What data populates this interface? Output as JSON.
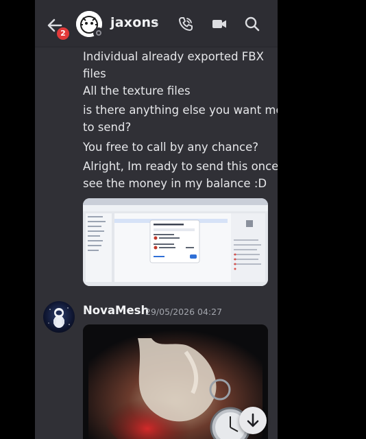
{
  "header": {
    "username": "jaxons",
    "chevron": "›",
    "back_badge": "2",
    "icons": [
      "back-arrow-icon",
      "phone-call-icon",
      "video-call-icon",
      "search-icon"
    ]
  },
  "messages": {
    "lines": [
      "Individual already exported FBX",
      "files",
      "All the texture files",
      "is there anything else you want me",
      "to send?",
      "You free to call by any chance?",
      "Alright, Im ready to send this once I",
      "see the money in my balance :D"
    ],
    "attachment": {
      "type": "screenshot",
      "dialog_title": "Share 'Apocrx Commission Files'"
    }
  },
  "author_message": {
    "author": "NovaMesh",
    "timestamp": "29/05/2026 04:27",
    "attachment": "image"
  },
  "colors": {
    "background": "#303036",
    "header": "#2d2d33",
    "text": "#e6e7ea",
    "muted": "#a3a6ad",
    "badge": "#e23a3a"
  }
}
